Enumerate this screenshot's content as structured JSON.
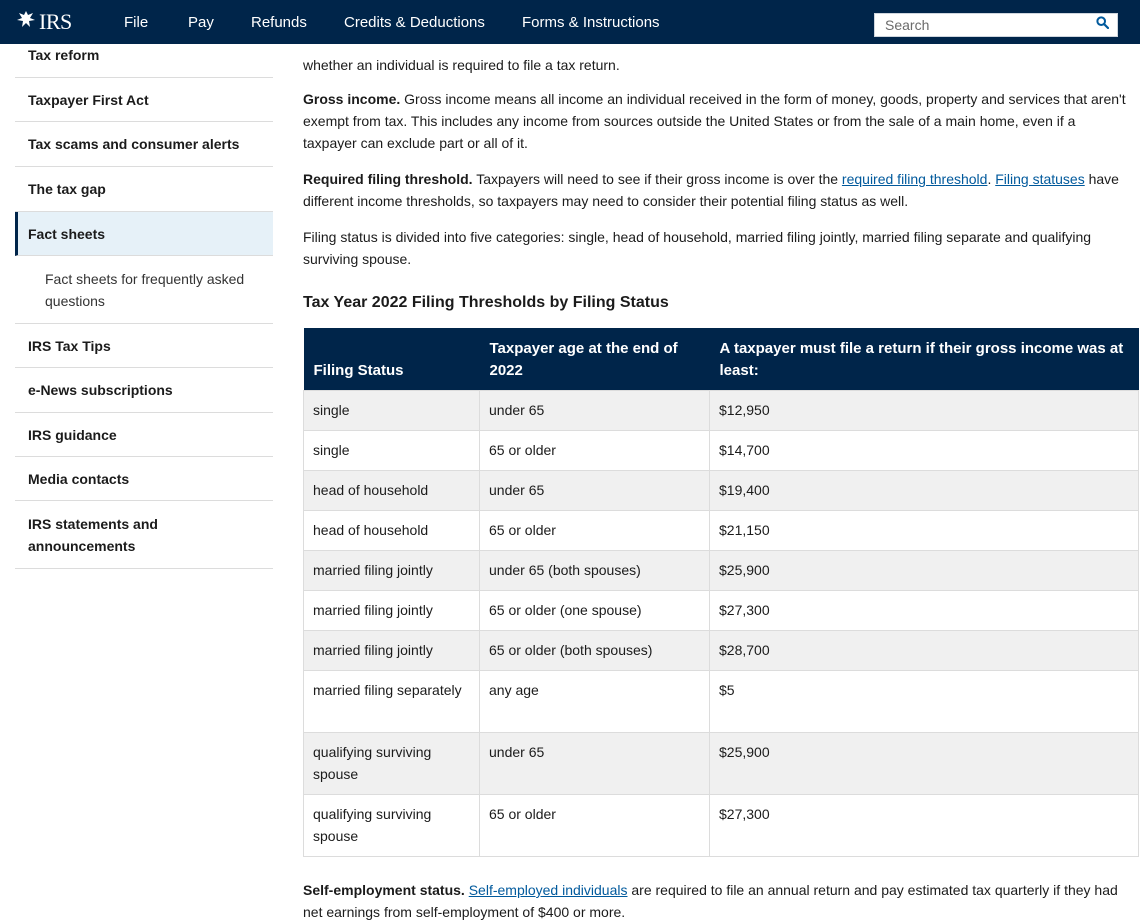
{
  "header": {
    "logo_text": "IRS",
    "logo_icon": "eagle-seal-icon",
    "nav": [
      "File",
      "Pay",
      "Refunds",
      "Credits & Deductions",
      "Forms & Instructions"
    ],
    "search_placeholder": "Search",
    "search_icon": "search-icon",
    "brand_color": "#00254a"
  },
  "sidebar": {
    "items": [
      {
        "label": "Tax reform"
      },
      {
        "label": "Taxpayer First Act"
      },
      {
        "label": "Tax scams and consumer alerts"
      },
      {
        "label": "The tax gap"
      },
      {
        "label": "Fact sheets",
        "active": true
      },
      {
        "label": "Fact sheets for frequently asked questions",
        "sub": true
      },
      {
        "label": "IRS Tax Tips"
      },
      {
        "label": "e-News subscriptions"
      },
      {
        "label": "IRS guidance"
      },
      {
        "label": "Media contacts"
      },
      {
        "label": "IRS statements and announcements"
      }
    ]
  },
  "content": {
    "intro_tail": "whether an individual is required to file a tax return.",
    "gross_income": {
      "term": "Gross income.",
      "text": " Gross income means all income an individual received in the form of money, goods, property and services that aren't exempt from tax. This includes any income from sources outside the United States or from the sale of a main home, even if a taxpayer can exclude part or all of it."
    },
    "threshold": {
      "term": "Required filing threshold.",
      "text_a": " Taxpayers will need to see if their gross income is over the ",
      "link1": "required filing threshold",
      "text_b": ". ",
      "link2": "Filing statuses",
      "text_c": " have different income thresholds, so taxpayers may need to consider their potential filing status as well."
    },
    "filing_status_para": "Filing status is divided into five categories: single, head of household, married filing jointly, married filing separate and qualifying surviving spouse.",
    "table_heading": "Tax Year 2022 Filing Thresholds by Filing Status",
    "table": {
      "headers": [
        "Filing Status",
        "Taxpayer age at the end of 2022",
        "A taxpayer must file a return if their gross income was at least:"
      ],
      "rows": [
        [
          "single",
          "under 65",
          "$12,950"
        ],
        [
          "single",
          "65 or older",
          "$14,700"
        ],
        [
          "head of household",
          "under 65",
          "$19,400"
        ],
        [
          "head of household",
          "65 or older",
          "$21,150"
        ],
        [
          "married filing jointly",
          "under 65 (both spouses)",
          "$25,900"
        ],
        [
          "married filing jointly",
          "65 or older (one spouse)",
          "$27,300"
        ],
        [
          "married filing jointly",
          "65 or older (both spouses)",
          "$28,700"
        ],
        [
          "married filing separately",
          "any age",
          "$5"
        ],
        [
          "qualifying surviving spouse",
          "under 65",
          "$25,900"
        ],
        [
          "qualifying surviving spouse",
          "65 or older",
          "$27,300"
        ]
      ]
    },
    "self_employment": {
      "term": "Self-employment status.",
      "space": " ",
      "link": "Self-employed individuals",
      "text": " are required to file an annual return and pay estimated tax quarterly if they had net earnings from self-employment of $400 or more."
    }
  }
}
